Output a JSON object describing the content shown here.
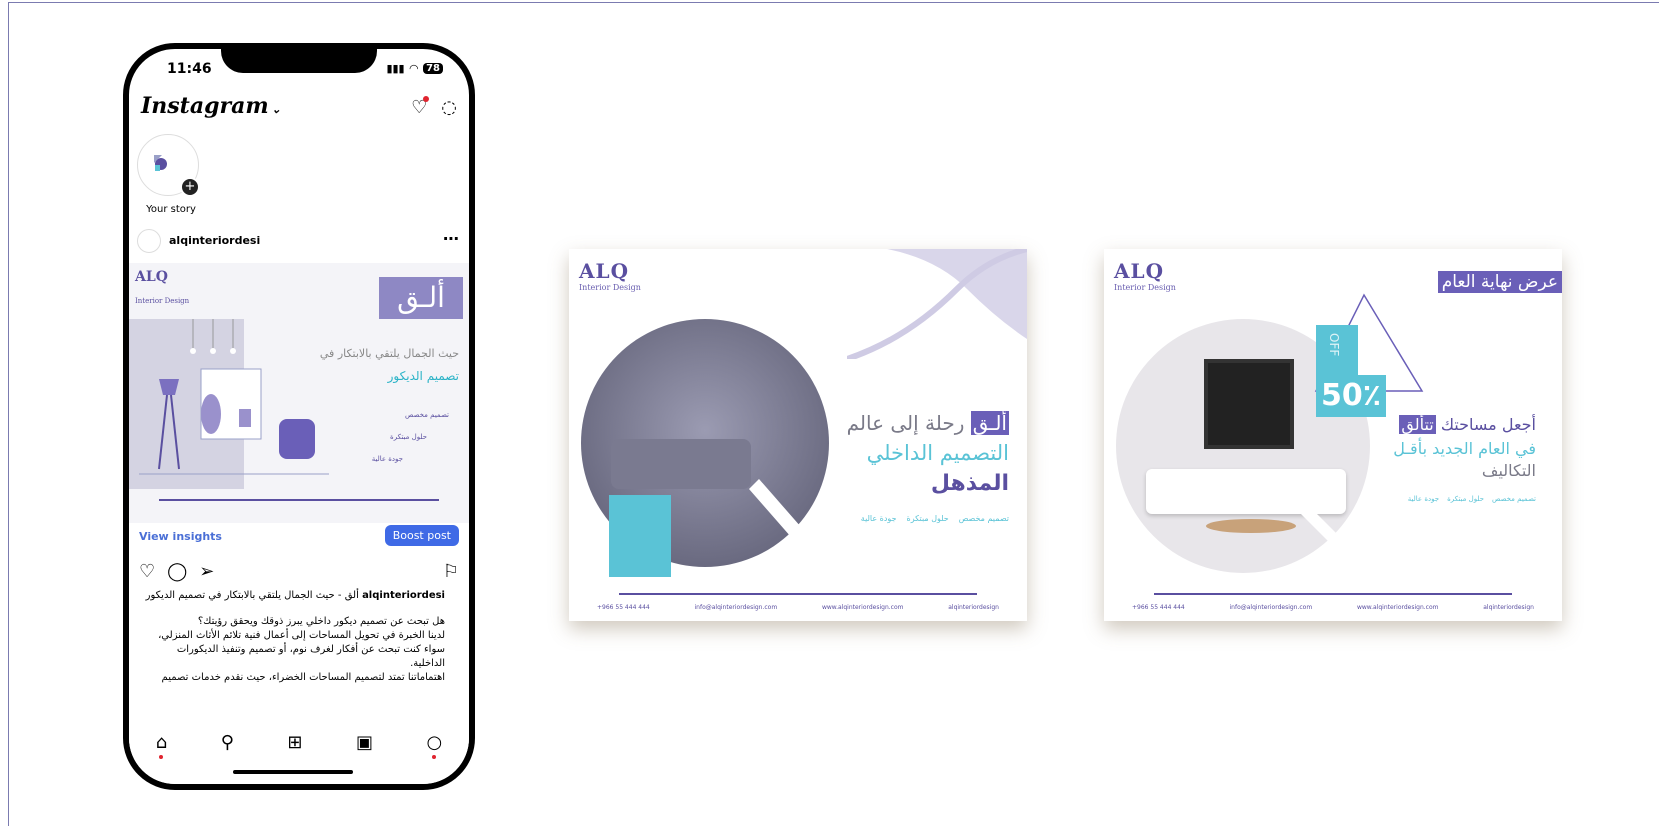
{
  "phone": {
    "time": "11:46",
    "battery": "78",
    "app_title": "Instagram",
    "story_label": "Your story",
    "post_user": "alqinteriordesi",
    "post_image": {
      "logo": "ALQ",
      "logo_sub": "Interior Design",
      "brand_ar": "ألـق",
      "headline_1": "حيث الجمال يلتقي بالابتكار في",
      "headline_2": "تصميم الديكور",
      "tag1": "تصميم مخصص",
      "tag2": "حلول مبتكرة",
      "tag3": "جودة عالية"
    },
    "view_insights": "View insights",
    "boost_post": "Boost post",
    "caption_user": "alqinteriordesi",
    "caption_title": "ألق - حيث الجمال يلتقي بالابتكار في تصميم الديكور",
    "caption_lines": [
      "هل تبحث عن تصميم ديكور داخلي يبرز ذوقك ويحقق رؤيتك؟",
      "لدينا الخبرة في تحويل المساحات إلى أعمال فنية تلائم الأثاث المنزلي،",
      "سواء كنت تبحث عن أفكار لغرف نوم، أو تصميم وتنفيذ الديكورات",
      "الداخلية.",
      "اهتماماتنا تمتد لتصميم المساحات الخضراء، حيث نقدم خدمات تصميم"
    ]
  },
  "card1": {
    "logo": "ALQ",
    "logo_sub": "Interior Design",
    "brand_ar": "ألـق",
    "line1_rest": "رحلة إلى عالم",
    "line2": "التصميم الداخلي",
    "line3": "المذهل",
    "tags": [
      "تصميم مخصص",
      "حلول مبتكرة",
      "جودة عالية"
    ],
    "phone": "+966 55 444 444",
    "email": "info@alqinteriordesign.com",
    "web": "www.alqinteriordesign.com",
    "social": "alqinteriordesign"
  },
  "card2": {
    "logo": "ALQ",
    "logo_sub": "Interior Design",
    "banner": "عرض نهاية العام",
    "off_label": "OFF",
    "discount": "50٪",
    "line1": "أجعل مساحتك",
    "brand_ar": "تتألق",
    "line2": "في العام الجديد بأقـل",
    "line3": "التكاليف",
    "tags": [
      "تصميم مخصص",
      "حلول مبتكرة",
      "جودة عالية"
    ],
    "phone": "+966 55 444 444",
    "email": "info@alqinteriordesign.com",
    "web": "www.alqinteriordesign.com",
    "social": "alqinteriordesign"
  },
  "colors": {
    "brand_purple": "#5a4fa0",
    "teal": "#5ac3d6",
    "boost_blue": "#3f6ae6"
  }
}
